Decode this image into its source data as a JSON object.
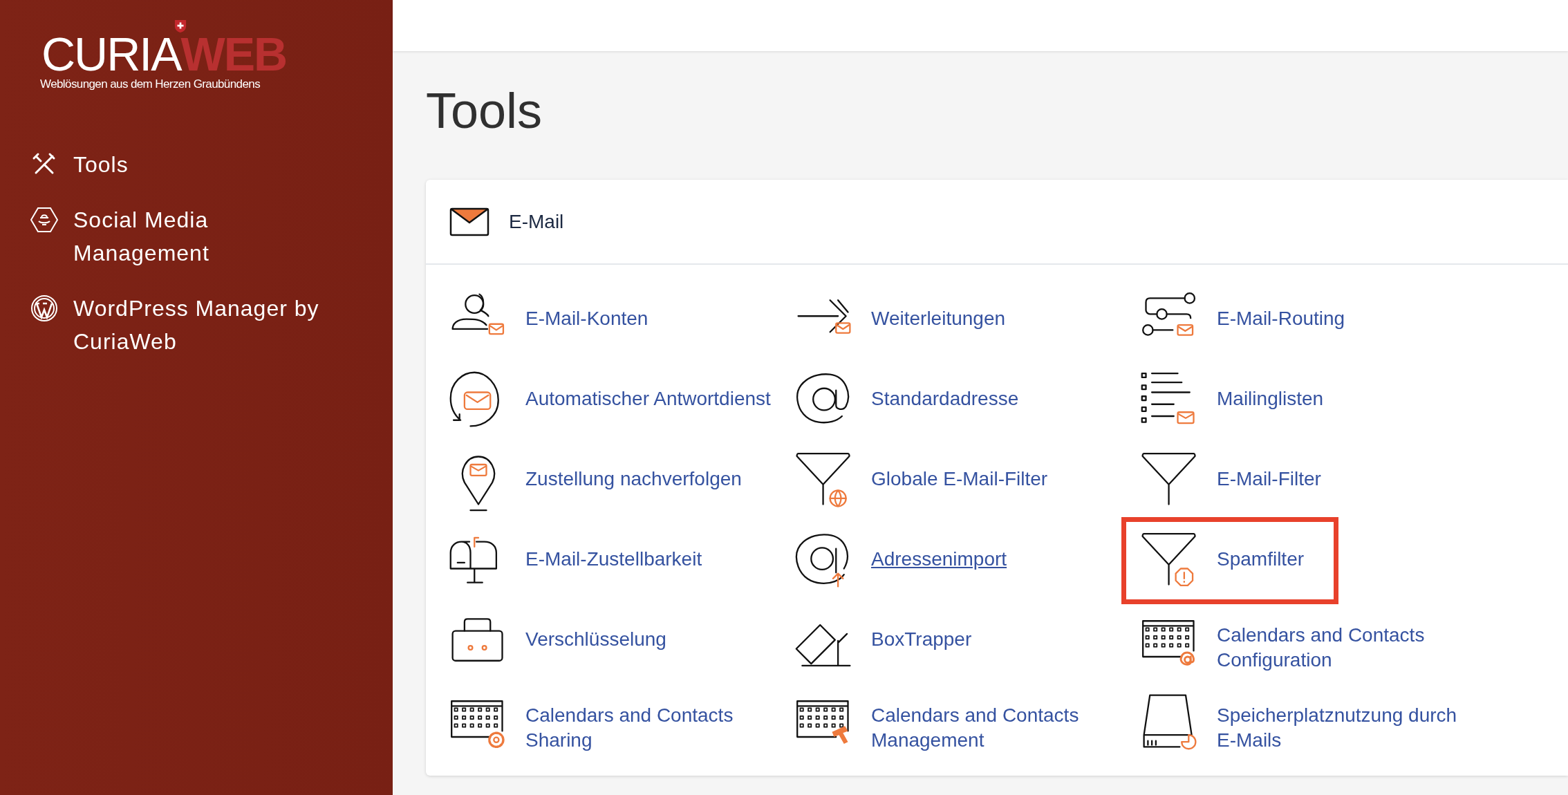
{
  "logo": {
    "primary": "CURIA",
    "accent": "WEB",
    "tagline": "Weblösungen aus dem Herzen Graubündens"
  },
  "sidebar": {
    "items": [
      {
        "label": "Tools",
        "kind": "tools",
        "selected": false
      },
      {
        "label": "Social Media Management",
        "kind": "hexagon",
        "selected": false
      },
      {
        "label": "WordPress Manager by CuriaWeb",
        "kind": "wordpress",
        "selected": false
      }
    ]
  },
  "page_title": "Tools",
  "section": {
    "title": "E-Mail",
    "items": [
      {
        "label": "E-Mail-Konten",
        "kind": "user-mail",
        "highlighted": false,
        "underlined": false
      },
      {
        "label": "Weiterleitungen",
        "kind": "forward-mail",
        "highlighted": false,
        "underlined": false
      },
      {
        "label": "E-Mail-Routing",
        "kind": "routing",
        "highlighted": false,
        "underlined": false
      },
      {
        "label": "Automatischer Antwortdienst",
        "kind": "autorespond",
        "highlighted": false,
        "underlined": false
      },
      {
        "label": "Standardadresse",
        "kind": "at",
        "highlighted": false,
        "underlined": false
      },
      {
        "label": "Mailinglisten",
        "kind": "list-mail",
        "highlighted": false,
        "underlined": false
      },
      {
        "label": "Zustellung nachverfolgen",
        "kind": "pin-mail",
        "highlighted": false,
        "underlined": false
      },
      {
        "label": "Globale E-Mail-Filter",
        "kind": "filter-globe",
        "highlighted": false,
        "underlined": false
      },
      {
        "label": "E-Mail-Filter",
        "kind": "filter",
        "highlighted": false,
        "underlined": false
      },
      {
        "label": "E-Mail-Zustellbarkeit",
        "kind": "mailbox",
        "highlighted": false,
        "underlined": false
      },
      {
        "label": "Adressenimport",
        "kind": "at-upload",
        "highlighted": false,
        "underlined": true
      },
      {
        "label": "Spamfilter",
        "kind": "filter-alert",
        "highlighted": true,
        "underlined": false
      },
      {
        "label": "Verschlüsselung",
        "kind": "briefcase",
        "highlighted": false,
        "underlined": false
      },
      {
        "label": "BoxTrapper",
        "kind": "boxtrapper",
        "highlighted": false,
        "underlined": false
      },
      {
        "label": "Calendars and Contacts Configuration",
        "kind": "calendar-at",
        "highlighted": false,
        "underlined": false
      },
      {
        "label": "Calendars and Contacts Sharing",
        "kind": "calendar-gear",
        "highlighted": false,
        "underlined": false
      },
      {
        "label": "Calendars and Contacts Management",
        "kind": "calendar-hammer",
        "highlighted": false,
        "underlined": false
      },
      {
        "label": "Speicherplatznutzung durch E-Mails",
        "kind": "disk-chart",
        "highlighted": false,
        "underlined": false
      }
    ]
  }
}
